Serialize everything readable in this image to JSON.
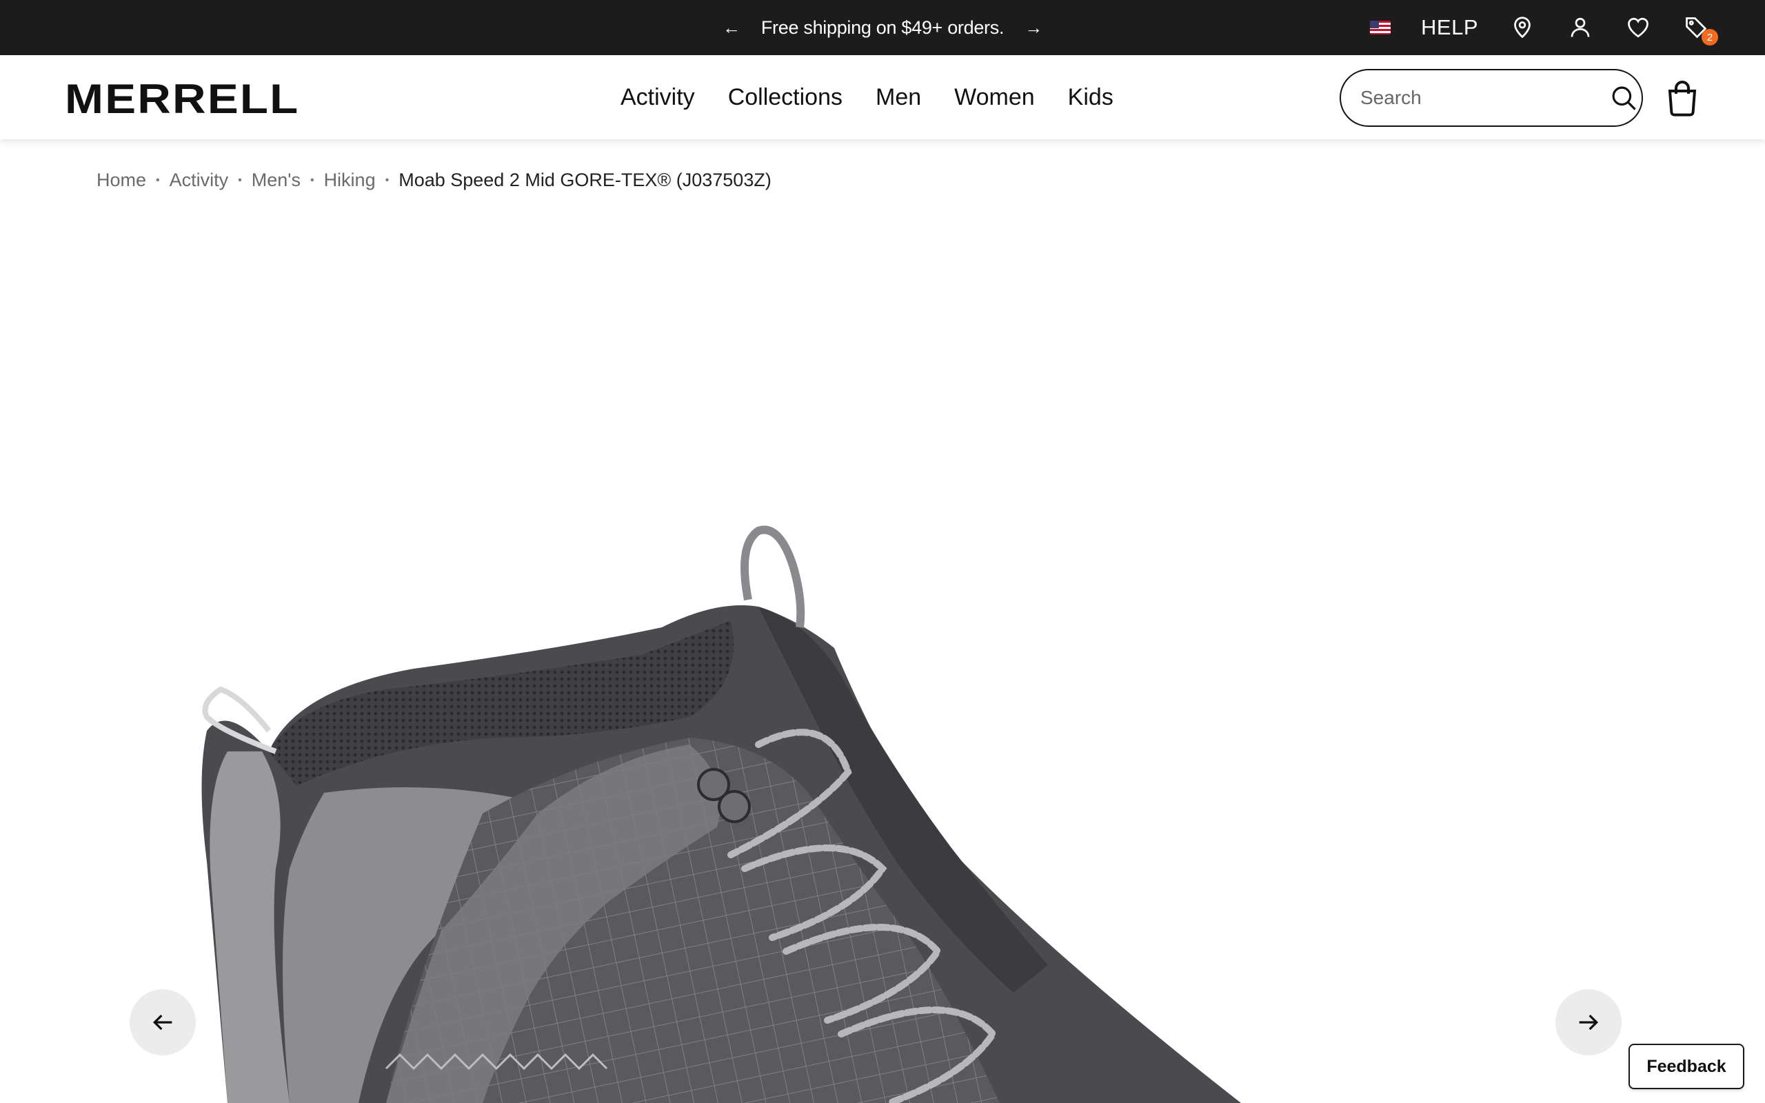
{
  "promo": {
    "message": "Free shipping on $49+ orders.",
    "prev_icon": "arrow-left-icon",
    "next_icon": "arrow-right-icon"
  },
  "utility": {
    "flag_icon": "us-flag-icon",
    "help_label": "HELP",
    "store_icon": "location-pin-icon",
    "account_icon": "user-icon",
    "wishlist_icon": "heart-icon",
    "offers_icon": "tag-icon",
    "offers_count": "2",
    "badge_color": "#f26b21"
  },
  "header": {
    "logo": "MERRELL",
    "nav": [
      "Activity",
      "Collections",
      "Men",
      "Women",
      "Kids"
    ],
    "search_placeholder": "Search",
    "bag_icon": "shopping-bag-icon"
  },
  "breadcrumb": {
    "items": [
      "Home",
      "Activity",
      "Men's",
      "Hiking"
    ],
    "current": "Moab Speed 2 Mid GORE-TEX® (J037503Z)"
  },
  "gallery": {
    "image_subject": "shoe-image",
    "prev_icon": "arrow-left-icon",
    "next_icon": "arrow-right-icon"
  },
  "feedback_label": "Feedback"
}
